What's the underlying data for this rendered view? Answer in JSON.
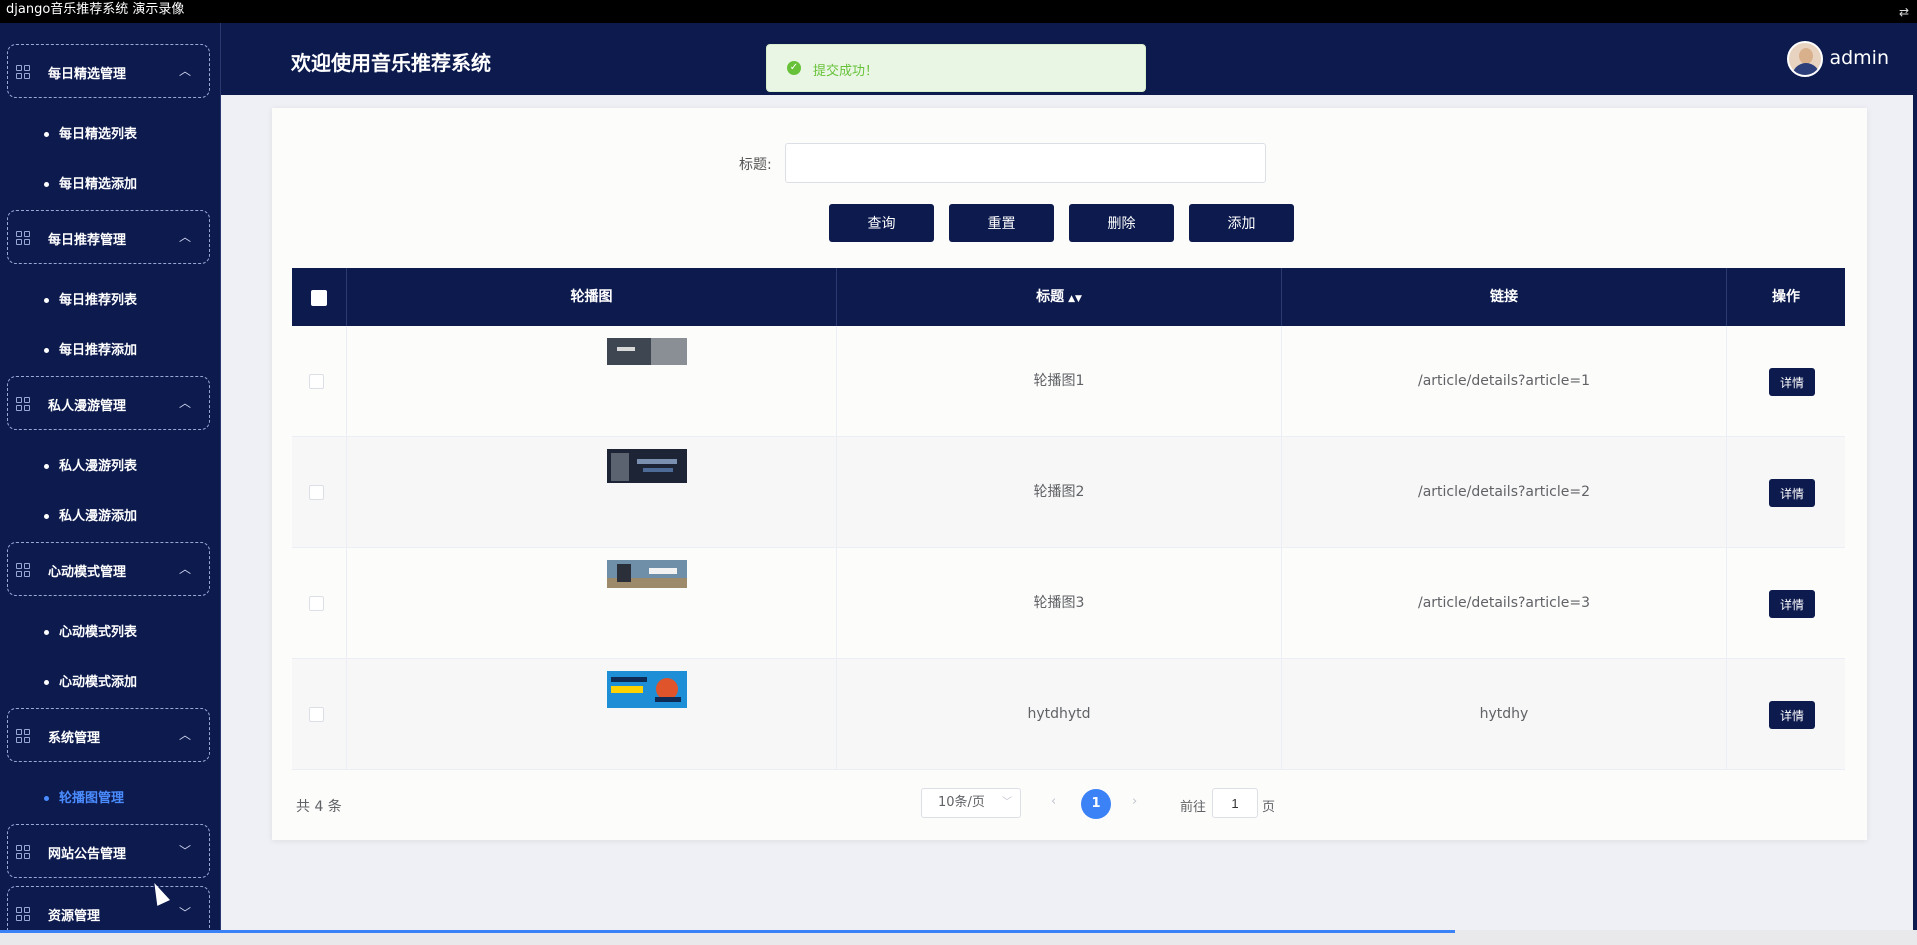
{
  "window": {
    "title": "django音乐推荐系统 演示录像"
  },
  "header": {
    "title": "欢迎使用音乐推荐系统",
    "username": "admin"
  },
  "toast": {
    "message": "提交成功！"
  },
  "sidebar": {
    "groups": [
      {
        "label": "每日精选管理",
        "expanded": true,
        "items": [
          "每日精选列表",
          "每日精选添加"
        ]
      },
      {
        "label": "每日推荐管理",
        "expanded": true,
        "items": [
          "每日推荐列表",
          "每日推荐添加"
        ]
      },
      {
        "label": "私人漫游管理",
        "expanded": true,
        "items": [
          "私人漫游列表",
          "私人漫游添加"
        ]
      },
      {
        "label": "心动模式管理",
        "expanded": true,
        "items": [
          "心动模式列表",
          "心动模式添加"
        ]
      },
      {
        "label": "系统管理",
        "expanded": true,
        "items": [
          "轮播图管理"
        ]
      },
      {
        "label": "网站公告管理",
        "expanded": false,
        "items": []
      },
      {
        "label": "资源管理",
        "expanded": false,
        "items": []
      }
    ],
    "active_item": "轮播图管理"
  },
  "search": {
    "label": "标题:",
    "value": ""
  },
  "buttons": {
    "query": "查询",
    "reset": "重置",
    "delete": "删除",
    "add": "添加"
  },
  "table": {
    "columns": [
      "轮播图",
      "标题",
      "链接",
      "操作"
    ],
    "rows": [
      {
        "title": "轮播图1",
        "link": "/article/details?article=1",
        "action": "详情",
        "thumb_color": "#3e4652"
      },
      {
        "title": "轮播图2",
        "link": "/article/details?article=2",
        "action": "详情",
        "thumb_color": "#1c2436"
      },
      {
        "title": "轮播图3",
        "link": "/article/details?article=3",
        "action": "详情",
        "thumb_color": "#6f8fa8"
      },
      {
        "title": "hytdhytd",
        "link": "hytdhy",
        "action": "详情",
        "thumb_color": "#1e8fd6"
      }
    ]
  },
  "pagination": {
    "total": "共 4 条",
    "page_size": "10条/页",
    "current_page": "1",
    "goto_label": "前往",
    "goto_value": "1",
    "page_unit": "页"
  },
  "colors": {
    "primary": "#0c1a4e",
    "accent": "#3a82f6",
    "success": "#67c23a"
  }
}
